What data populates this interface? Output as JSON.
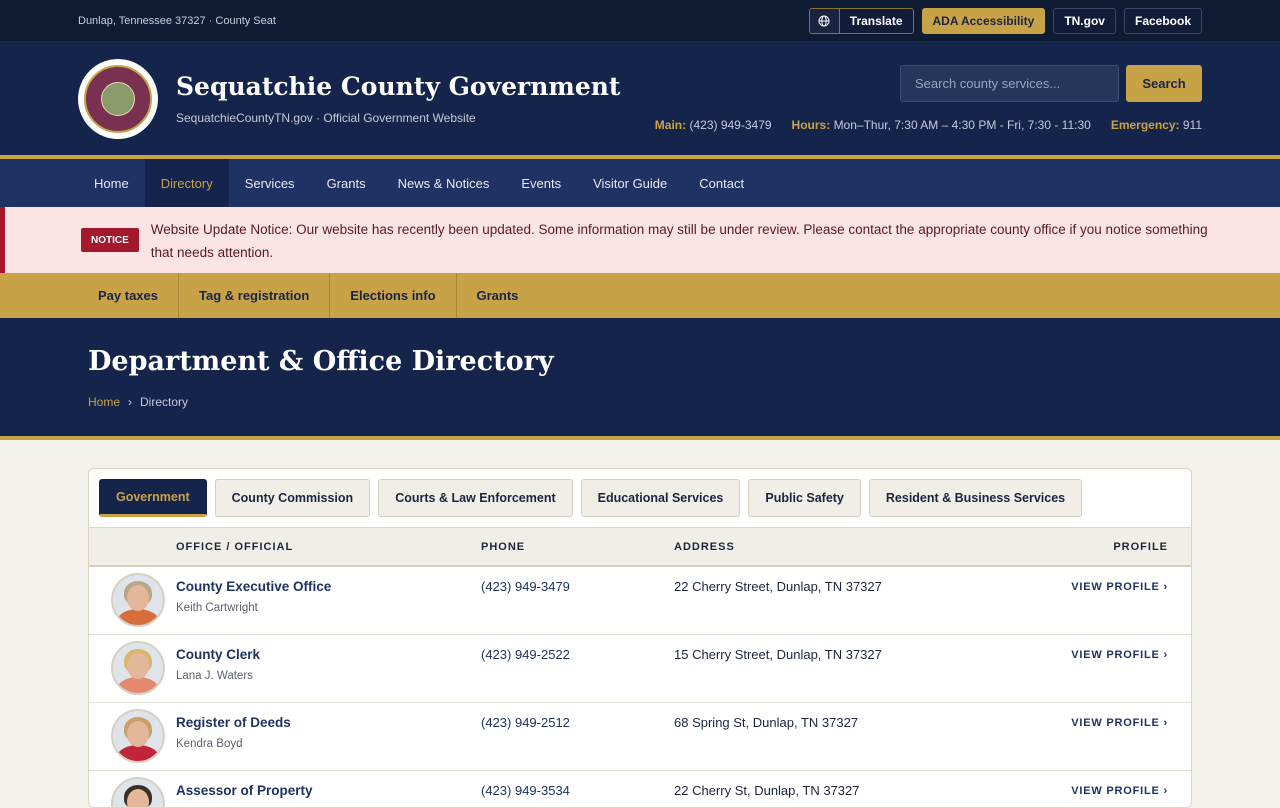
{
  "topbar": {
    "location": "Dunlap, Tennessee 37327 · County Seat",
    "translate_label": "Translate",
    "links": [
      "ADA Accessibility",
      "TN.gov",
      "Facebook"
    ]
  },
  "header": {
    "title": "Sequatchie County Government",
    "subtitle": "SequatchieCountyTN.gov · Official Government Website",
    "search_placeholder": "Search county services...",
    "search_button": "Search",
    "contacts": [
      {
        "label": "Main:",
        "value": "(423) 949-3479"
      },
      {
        "label": "Hours:",
        "value": "Mon–Thur, 7:30 AM – 4:30 PM - Fri, 7:30 - 11:30"
      },
      {
        "label": "Emergency:",
        "value": "911"
      }
    ]
  },
  "nav": {
    "items": [
      "Home",
      "Directory",
      "Services",
      "Grants",
      "News & Notices",
      "Events",
      "Visitor Guide",
      "Contact"
    ],
    "active": "Directory"
  },
  "notice": {
    "badge": "NOTICE",
    "text": "Website Update Notice: Our website has recently been updated. Some information may still be under review. Please contact the appropriate county office if you notice something that needs attention."
  },
  "quick_links": [
    "Pay taxes",
    "Tag & registration",
    "Elections info",
    "Grants"
  ],
  "hero": {
    "title": "Department & Office Directory",
    "breadcrumb": [
      "Home",
      "Directory"
    ]
  },
  "directory": {
    "tabs": [
      "Government",
      "County Commission",
      "Courts & Law Enforcement",
      "Educational Services",
      "Public Safety",
      "Resident & Business Services"
    ],
    "active_tab": "Government",
    "columns": [
      "OFFICE / OFFICIAL",
      "PHONE",
      "ADDRESS",
      "PROFILE"
    ],
    "rows": [
      {
        "office": "County Executive Office",
        "official": "Keith Cartwright",
        "phone": "(423) 949-3479",
        "address": "22 Cherry Street, Dunlap, TN 37327",
        "profile": "VIEW PROFILE ›"
      },
      {
        "office": "County Clerk",
        "official": "Lana J. Waters",
        "phone": "(423) 949-2522",
        "address": "15 Cherry Street, Dunlap, TN 37327",
        "profile": "VIEW PROFILE ›"
      },
      {
        "office": "Register of Deeds",
        "official": "Kendra Boyd",
        "phone": "(423) 949-2512",
        "address": "68 Spring St, Dunlap, TN 37327",
        "profile": "VIEW PROFILE ›"
      },
      {
        "office": "Assessor of Property",
        "official": "",
        "phone": "(423) 949-3534",
        "address": "22 Cherry St, Dunlap, TN 37327",
        "profile": "VIEW PROFILE ›"
      }
    ]
  },
  "colors": {
    "navy": "#15244a",
    "gold": "#c8a247",
    "notice_red": "#a3182a"
  }
}
